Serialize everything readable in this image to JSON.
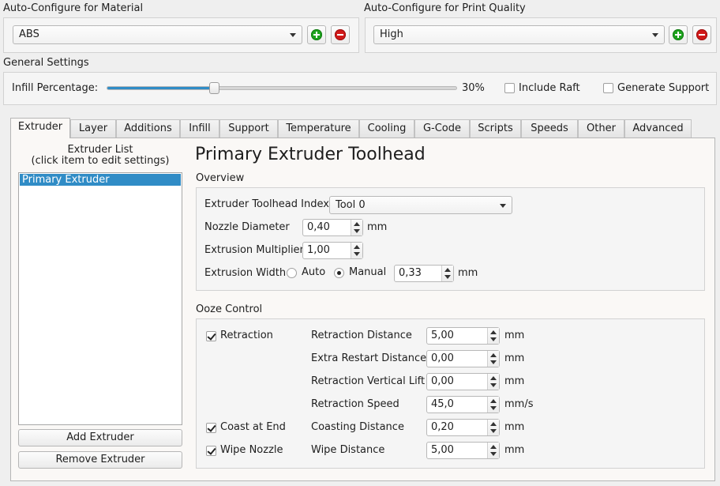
{
  "material": {
    "title": "Auto-Configure for Material",
    "selected": "ABS"
  },
  "quality": {
    "title": "Auto-Configure for Print Quality",
    "selected": "High"
  },
  "general": {
    "title": "General Settings",
    "infill_label": "Infill Percentage:",
    "infill_value": "30%",
    "infill_fraction": 0.3,
    "include_raft": "Include Raft",
    "generate_support": "Generate Support"
  },
  "tabs": [
    "Extruder",
    "Layer",
    "Additions",
    "Infill",
    "Support",
    "Temperature",
    "Cooling",
    "G-Code",
    "Scripts",
    "Speeds",
    "Other",
    "Advanced"
  ],
  "extruder_list": {
    "title_line1": "Extruder List",
    "title_line2": "(click item to edit settings)",
    "items": [
      "Primary Extruder"
    ],
    "add_label": "Add Extruder",
    "remove_label": "Remove Extruder"
  },
  "editor": {
    "heading": "Primary Extruder Toolhead",
    "overview": {
      "title": "Overview",
      "toolhead_label": "Extruder Toolhead Index",
      "toolhead_value": "Tool 0",
      "nozzle_label": "Nozzle Diameter",
      "nozzle_value": "0,40",
      "nozzle_unit": "mm",
      "multiplier_label": "Extrusion Multiplier",
      "multiplier_value": "1,00",
      "width_label": "Extrusion Width",
      "auto_label": "Auto",
      "manual_label": "Manual",
      "width_value": "0,33",
      "width_unit": "mm"
    },
    "ooze": {
      "title": "Ooze Control",
      "retraction_label": "Retraction",
      "coast_label": "Coast at End",
      "wipe_label": "Wipe Nozzle",
      "rows": [
        {
          "label": "Retraction Distance",
          "value": "5,00",
          "unit": "mm"
        },
        {
          "label": "Extra Restart Distance",
          "value": "0,00",
          "unit": "mm"
        },
        {
          "label": "Retraction Vertical Lift",
          "value": "0,00",
          "unit": "mm"
        },
        {
          "label": "Retraction Speed",
          "value": "45,0",
          "unit": "mm/s"
        },
        {
          "label": "Coasting Distance",
          "value": "0,20",
          "unit": "mm"
        },
        {
          "label": "Wipe Distance",
          "value": "5,00",
          "unit": "mm"
        }
      ]
    }
  },
  "colors": {
    "accent": "#308cc6",
    "add_green": "#1ea31e",
    "remove_red": "#d11919"
  }
}
